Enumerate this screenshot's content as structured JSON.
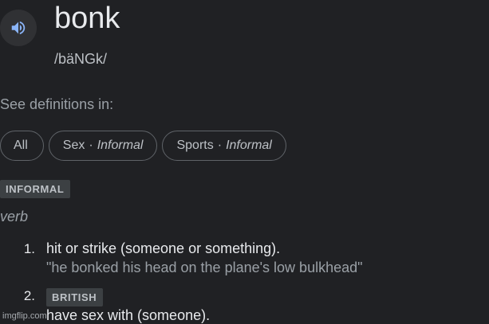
{
  "entry": {
    "word": "bonk",
    "pronunciation": "/bäNGk/",
    "speaker_icon": "volume-icon"
  },
  "see_definitions": {
    "label": "See definitions in:",
    "chips": [
      {
        "label": "All"
      },
      {
        "label": "Sex",
        "separator": "·",
        "qualifier": "Informal"
      },
      {
        "label": "Sports",
        "separator": "·",
        "qualifier": "Informal"
      }
    ]
  },
  "register_badge": "INFORMAL",
  "part_of_speech": "verb",
  "senses": [
    {
      "number": "1.",
      "definition": "hit or strike (someone or something).",
      "example": "\"he bonked his head on the plane's low bulkhead\""
    },
    {
      "number": "2.",
      "badge": "BRITISH",
      "definition": "have sex with (someone)."
    }
  ],
  "watermark": "imgflip.com",
  "colors": {
    "background": "#202124",
    "text_primary": "#e8eaed",
    "text_secondary": "#9aa0a6",
    "chip_border": "#5f6368",
    "badge_bg": "#3c4043"
  }
}
